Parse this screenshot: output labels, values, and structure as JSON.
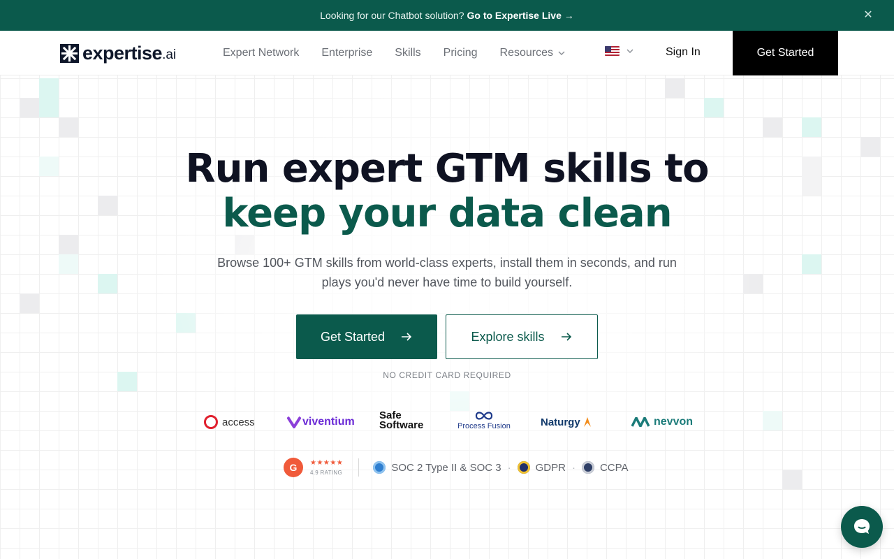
{
  "announcement": {
    "text": "Looking for our Chatbot solution?",
    "link_label": "Go to Expertise Live →",
    "close_icon": "close-icon"
  },
  "header": {
    "logo_word": "expertise",
    "logo_suffix": ".ai",
    "nav": [
      {
        "label": "Expert Network"
      },
      {
        "label": "Enterprise"
      },
      {
        "label": "Skills"
      },
      {
        "label": "Pricing"
      },
      {
        "label": "Resources",
        "has_dropdown": true
      }
    ],
    "language": {
      "icon": "us-flag-icon"
    },
    "sign_in": "Sign In",
    "cta": "Get Started"
  },
  "hero": {
    "title_line1": "Run expert GTM skills to",
    "title_line2": "keep your data clean",
    "subtitle": "Browse 100+ GTM skills from world-class experts, install them in seconds, and run plays you'd never have time to build yourself.",
    "primary_cta": "Get Started",
    "secondary_cta": "Explore skills",
    "note": "NO CREDIT CARD REQUIRED"
  },
  "logos": {
    "access": "access",
    "viventium": "viventium",
    "safe_software_1": "Safe",
    "safe_software_2": "Software",
    "process_fusion": "Process Fusion",
    "naturgy": "Naturgy",
    "nevvon": "nevvon"
  },
  "trust": {
    "g2_badge": "G",
    "g2_stars": "★★★★★",
    "g2_rating": "4.9 RATING",
    "soc": "SOC 2 Type II & SOC 3",
    "gdpr": "GDPR",
    "ccpa": "CCPA",
    "separator": "·"
  },
  "colors": {
    "brand_green": "#0b5a4c",
    "header_cta_bg": "#000000",
    "g2_orange": "#f05a3a"
  }
}
